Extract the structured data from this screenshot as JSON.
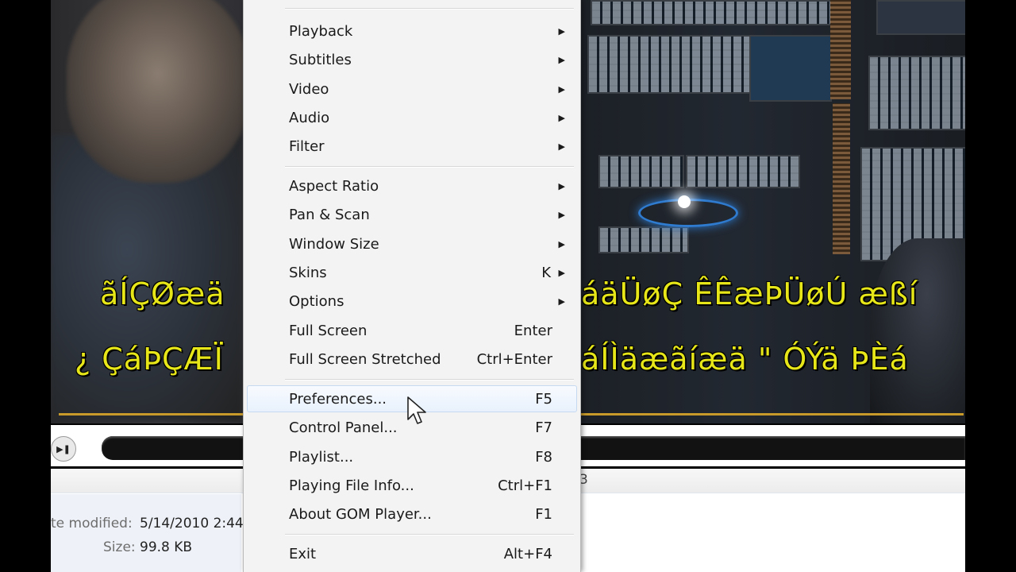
{
  "subtitles": {
    "line1_left": "ãÍÇØæä",
    "line1_right": "áäÜøÇ ÊÊæÞÜøÚ æßí",
    "line2_left": "¿ ÇáÞÇÆÏ",
    "line2_right": "áÍÌäæãíæä \" ÓÝä ÞÈá"
  },
  "controls": {
    "play_glyph": "▶❚"
  },
  "details": {
    "date_label": "te modified:",
    "date_value": "5/14/2010 2:44",
    "size_label": "Size:",
    "size_value": "99.8 KB",
    "fragment": "3"
  },
  "menu": {
    "items": [
      {
        "label": "Playback",
        "shortcut": "",
        "submenu": true
      },
      {
        "label": "Subtitles",
        "shortcut": "",
        "submenu": true
      },
      {
        "label": "Video",
        "shortcut": "",
        "submenu": true
      },
      {
        "label": "Audio",
        "shortcut": "",
        "submenu": true
      },
      {
        "label": "Filter",
        "shortcut": "",
        "submenu": true
      },
      {
        "label": "Aspect Ratio",
        "shortcut": "",
        "submenu": true
      },
      {
        "label": "Pan & Scan",
        "shortcut": "",
        "submenu": true
      },
      {
        "label": "Window Size",
        "shortcut": "",
        "submenu": true
      },
      {
        "label": "Skins",
        "shortcut": "K",
        "submenu": true
      },
      {
        "label": "Options",
        "shortcut": "",
        "submenu": true
      },
      {
        "label": "Full Screen",
        "shortcut": "Enter",
        "submenu": false
      },
      {
        "label": "Full Screen Stretched",
        "shortcut": "Ctrl+Enter",
        "submenu": false
      },
      {
        "label": "Preferences...",
        "shortcut": "F5",
        "submenu": false,
        "highlighted": true
      },
      {
        "label": "Control Panel...",
        "shortcut": "F7",
        "submenu": false
      },
      {
        "label": "Playlist...",
        "shortcut": "F8",
        "submenu": false
      },
      {
        "label": "Playing File Info...",
        "shortcut": "Ctrl+F1",
        "submenu": false
      },
      {
        "label": "About GOM Player...",
        "shortcut": "F1",
        "submenu": false
      },
      {
        "label": "Exit",
        "shortcut": "Alt+F4",
        "submenu": false
      }
    ],
    "arrow_glyph": "▶"
  },
  "colors": {
    "subtitle": "#e6e619",
    "highlight_bg": "#e8f1fc",
    "menu_bg": "#f3f3f3"
  }
}
